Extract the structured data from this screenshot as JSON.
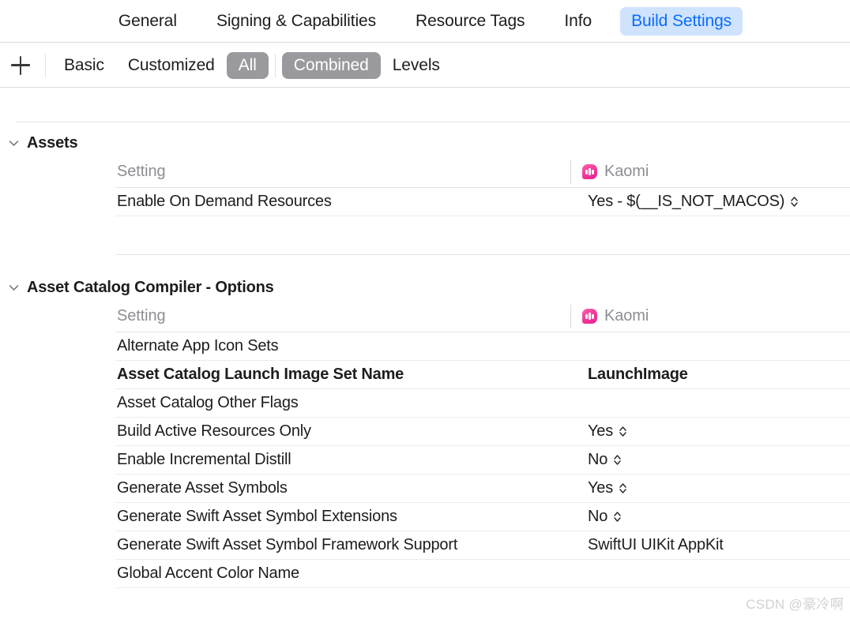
{
  "tabs": [
    {
      "label": "General",
      "selected": false
    },
    {
      "label": "Signing & Capabilities",
      "selected": false
    },
    {
      "label": "Resource Tags",
      "selected": false
    },
    {
      "label": "Info",
      "selected": false
    },
    {
      "label": "Build Settings",
      "selected": true
    }
  ],
  "toolbar": {
    "add_label": "+",
    "segments": [
      {
        "label": "Basic",
        "active": false
      },
      {
        "label": "Customized",
        "active": false
      },
      {
        "label": "All",
        "active": true
      },
      {
        "label": "Combined",
        "active": true
      },
      {
        "label": "Levels",
        "active": false
      }
    ]
  },
  "columns": {
    "setting_header": "Setting",
    "target_name": "Kaomi",
    "target_icon": "chat-waveform-icon"
  },
  "groups": [
    {
      "title": "Assets",
      "expanded": true,
      "rows": [
        {
          "name": "Enable On Demand Resources",
          "value": "Yes  -  $(__IS_NOT_MACOS)",
          "stepper": true,
          "bold": false
        }
      ]
    },
    {
      "title": "Asset Catalog Compiler - Options",
      "expanded": true,
      "rows": [
        {
          "name": "Alternate App Icon Sets",
          "value": "",
          "stepper": false,
          "bold": false
        },
        {
          "name": "Asset Catalog Launch Image Set Name",
          "value": "LaunchImage",
          "stepper": false,
          "bold": true
        },
        {
          "name": "Asset Catalog Other Flags",
          "value": "",
          "stepper": false,
          "bold": false
        },
        {
          "name": "Build Active Resources Only",
          "value": "Yes",
          "stepper": true,
          "bold": false
        },
        {
          "name": "Enable Incremental Distill",
          "value": "No",
          "stepper": true,
          "bold": false
        },
        {
          "name": "Generate Asset Symbols",
          "value": "Yes",
          "stepper": true,
          "bold": false
        },
        {
          "name": "Generate Swift Asset Symbol Extensions",
          "value": "No",
          "stepper": true,
          "bold": false
        },
        {
          "name": "Generate Swift Asset Symbol Framework Support",
          "value": "SwiftUI UIKit AppKit",
          "stepper": false,
          "bold": false
        },
        {
          "name": "Global Accent Color Name",
          "value": "",
          "stepper": false,
          "bold": false
        }
      ]
    }
  ],
  "watermark": "CSDN @豪冷啊",
  "colors": {
    "accent_blue": "#0a6cff",
    "tab_selected_bg": "#cfe3fd",
    "segment_active_bg": "#9a9a9e",
    "target_pink": "#f0389b",
    "text_primary": "#1d1d1f",
    "text_muted": "#8e8e93"
  }
}
